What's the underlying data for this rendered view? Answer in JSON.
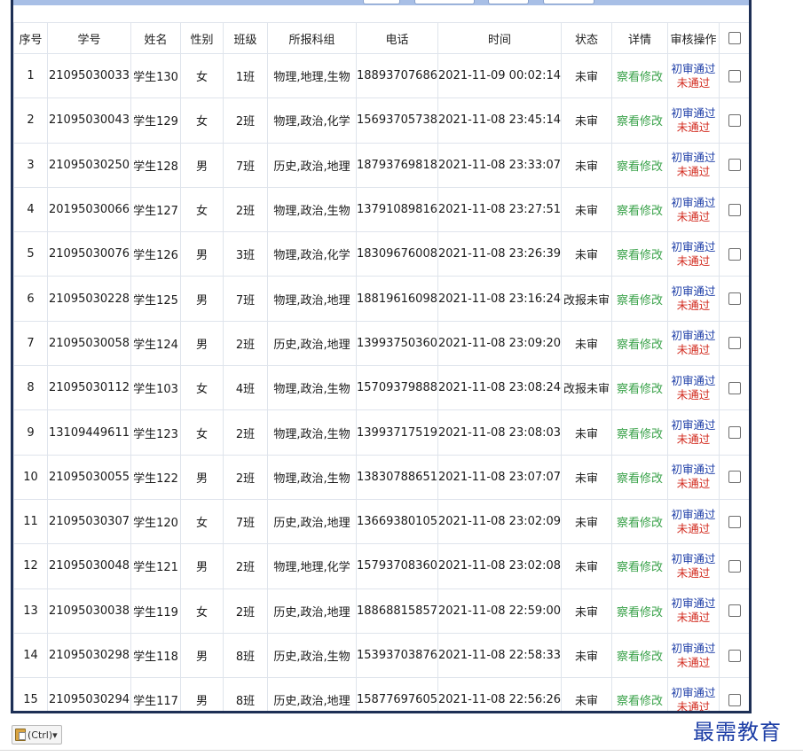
{
  "table": {
    "headers": [
      "序号",
      "学号",
      "姓名",
      "性别",
      "班级",
      "所报科组",
      "电话",
      "时间",
      "状态",
      "详情",
      "审核操作"
    ],
    "rows": [
      {
        "no": "1",
        "id": "21095030033",
        "name": "学生130",
        "gender": "女",
        "cls": "1班",
        "subjects": "物理,地理,生物",
        "phone": "18893707686",
        "time": "2021-11-09 00:02:14",
        "status": "未审",
        "detail": "察看修改",
        "pass": "初审通过",
        "fail": "未通过"
      },
      {
        "no": "2",
        "id": "21095030043",
        "name": "学生129",
        "gender": "女",
        "cls": "2班",
        "subjects": "物理,政治,化学",
        "phone": "15693705738",
        "time": "2021-11-08 23:45:14",
        "status": "未审",
        "detail": "察看修改",
        "pass": "初审通过",
        "fail": "未通过"
      },
      {
        "no": "3",
        "id": "21095030250",
        "name": "学生128",
        "gender": "男",
        "cls": "7班",
        "subjects": "历史,政治,地理",
        "phone": "18793769818",
        "time": "2021-11-08 23:33:07",
        "status": "未审",
        "detail": "察看修改",
        "pass": "初审通过",
        "fail": "未通过"
      },
      {
        "no": "4",
        "id": "20195030066",
        "name": "学生127",
        "gender": "女",
        "cls": "2班",
        "subjects": "物理,政治,生物",
        "phone": "13791089816",
        "time": "2021-11-08 23:27:51",
        "status": "未审",
        "detail": "察看修改",
        "pass": "初审通过",
        "fail": "未通过"
      },
      {
        "no": "5",
        "id": "21095030076",
        "name": "学生126",
        "gender": "男",
        "cls": "3班",
        "subjects": "物理,政治,化学",
        "phone": "18309676008",
        "time": "2021-11-08 23:26:39",
        "status": "未审",
        "detail": "察看修改",
        "pass": "初审通过",
        "fail": "未通过"
      },
      {
        "no": "6",
        "id": "21095030228",
        "name": "学生125",
        "gender": "男",
        "cls": "7班",
        "subjects": "物理,政治,地理",
        "phone": "18819616098",
        "time": "2021-11-08 23:16:24",
        "status": "改报未审",
        "detail": "察看修改",
        "pass": "初审通过",
        "fail": "未通过"
      },
      {
        "no": "7",
        "id": "21095030058",
        "name": "学生124",
        "gender": "男",
        "cls": "2班",
        "subjects": "历史,政治,地理",
        "phone": "13993750360",
        "time": "2021-11-08 23:09:20",
        "status": "未审",
        "detail": "察看修改",
        "pass": "初审通过",
        "fail": "未通过"
      },
      {
        "no": "8",
        "id": "21095030112",
        "name": "学生103",
        "gender": "女",
        "cls": "4班",
        "subjects": "物理,政治,生物",
        "phone": "15709379888",
        "time": "2021-11-08 23:08:24",
        "status": "改报未审",
        "detail": "察看修改",
        "pass": "初审通过",
        "fail": "未通过"
      },
      {
        "no": "9",
        "id": "13109449611",
        "name": "学生123",
        "gender": "女",
        "cls": "2班",
        "subjects": "物理,政治,生物",
        "phone": "13993717519",
        "time": "2021-11-08 23:08:03",
        "status": "未审",
        "detail": "察看修改",
        "pass": "初审通过",
        "fail": "未通过"
      },
      {
        "no": "10",
        "id": "21095030055",
        "name": "学生122",
        "gender": "男",
        "cls": "2班",
        "subjects": "物理,政治,生物",
        "phone": "13830788651",
        "time": "2021-11-08 23:07:07",
        "status": "未审",
        "detail": "察看修改",
        "pass": "初审通过",
        "fail": "未通过"
      },
      {
        "no": "11",
        "id": "21095030307",
        "name": "学生120",
        "gender": "女",
        "cls": "7班",
        "subjects": "历史,政治,地理",
        "phone": "13669380105",
        "time": "2021-11-08 23:02:09",
        "status": "未审",
        "detail": "察看修改",
        "pass": "初审通过",
        "fail": "未通过"
      },
      {
        "no": "12",
        "id": "21095030048",
        "name": "学生121",
        "gender": "男",
        "cls": "2班",
        "subjects": "物理,地理,化学",
        "phone": "15793708360",
        "time": "2021-11-08 23:02:08",
        "status": "未审",
        "detail": "察看修改",
        "pass": "初审通过",
        "fail": "未通过"
      },
      {
        "no": "13",
        "id": "21095030038",
        "name": "学生119",
        "gender": "女",
        "cls": "2班",
        "subjects": "历史,政治,地理",
        "phone": "18868815857",
        "time": "2021-11-08 22:59:00",
        "status": "未审",
        "detail": "察看修改",
        "pass": "初审通过",
        "fail": "未通过"
      },
      {
        "no": "14",
        "id": "21095030298",
        "name": "学生118",
        "gender": "男",
        "cls": "8班",
        "subjects": "历史,政治,生物",
        "phone": "15393703876",
        "time": "2021-11-08 22:58:33",
        "status": "未审",
        "detail": "察看修改",
        "pass": "初审通过",
        "fail": "未通过"
      },
      {
        "no": "15",
        "id": "21095030294",
        "name": "学生117",
        "gender": "男",
        "cls": "8班",
        "subjects": "历史,政治,地理",
        "phone": "15877697605",
        "time": "2021-11-08 22:56:26",
        "status": "未审",
        "detail": "察看修改",
        "pass": "初审通过",
        "fail": "未通过"
      }
    ]
  },
  "paste_options": {
    "label": "(Ctrl)▾",
    "icon": "clipboard-icon"
  },
  "watermark": {
    "text": "最需教育"
  },
  "colors": {
    "detail": "#3aa24a",
    "pass": "#1f3fa8",
    "fail": "#d22a1e",
    "frame": "#1d2f55"
  }
}
